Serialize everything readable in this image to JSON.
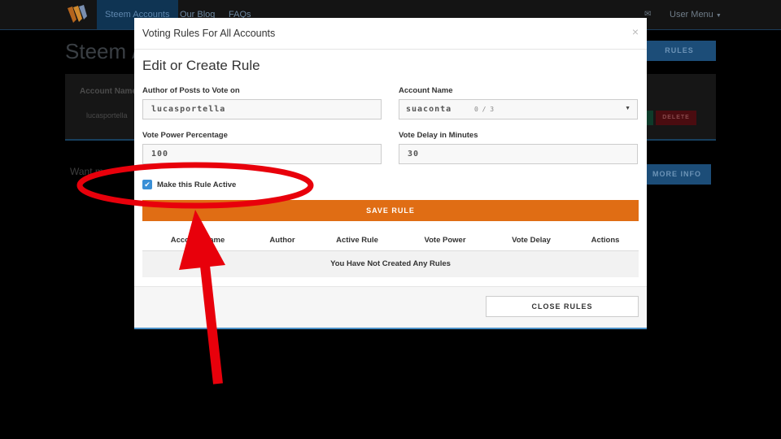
{
  "navbar": {
    "tabs": [
      "Steem Accounts",
      "Our Blog",
      "FAQs"
    ],
    "user_menu": "User Menu"
  },
  "background": {
    "page_title": "Steem /",
    "rules_button": "RULES",
    "table_header": "Account Name",
    "table_row_account": "lucasportella",
    "delete_button": "DELETE",
    "want_more_text": "Want m",
    "more_info_button": "MORE INFO"
  },
  "modal": {
    "title": "Voting Rules For All Accounts",
    "close_symbol": "×",
    "section_title": "Edit or Create Rule",
    "author_label": "Author of Posts to Vote on",
    "author_value": "lucasportella",
    "account_label": "Account Name",
    "account_selected": "suaconta",
    "account_count": "0 / 3",
    "vote_power_label": "Vote Power Percentage",
    "vote_power_value": "100",
    "vote_delay_label": "Vote Delay in Minutes",
    "vote_delay_value": "30",
    "active_checkbox_label": "Make this Rule Active",
    "active_checked": true,
    "save_button": "SAVE RULE",
    "table_columns": [
      "Account Name",
      "Author",
      "Active Rule",
      "Vote Power",
      "Vote Delay",
      "Actions"
    ],
    "empty_message": "You Have Not Created Any Rules",
    "close_rules_button": "CLOSE RULES"
  },
  "colors": {
    "accent_orange": "#e06d14",
    "checkbox_blue": "#3a8fd6",
    "annotation_red": "#e8000b"
  },
  "icons": {
    "logo": "steem-logo-icon",
    "mail": "envelope-icon",
    "caret": "caret-down-icon",
    "check": "checkmark-icon",
    "close": "close-icon"
  }
}
